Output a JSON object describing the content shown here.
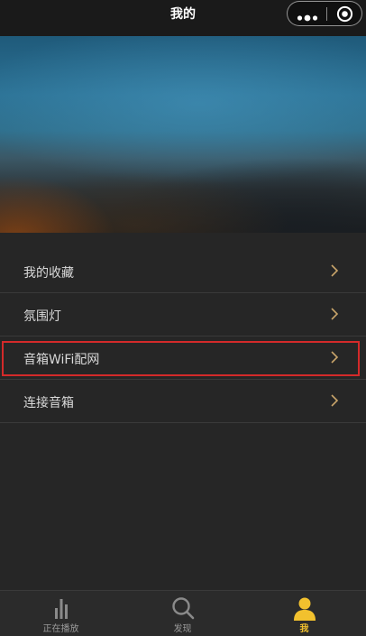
{
  "navbar": {
    "title": "我的",
    "capsule_more_icon": "more-dots-icon",
    "capsule_close_icon": "target-circle-icon"
  },
  "hero": {
    "description": ""
  },
  "menu": {
    "items": [
      {
        "label": "我的收藏",
        "icon": "chevron-right-icon"
      },
      {
        "label": "氛围灯",
        "icon": "chevron-right-icon"
      },
      {
        "label": "音箱WiFi配网",
        "icon": "chevron-right-icon",
        "highlighted": true
      },
      {
        "label": "连接音箱",
        "icon": "chevron-right-icon"
      }
    ]
  },
  "tabbar": {
    "tabs": [
      {
        "label": "正在播放",
        "icon": "equalizer-bars-icon",
        "active": false
      },
      {
        "label": "发现",
        "icon": "search-icon",
        "active": false
      },
      {
        "label": "我",
        "icon": "user-icon",
        "active": true
      }
    ]
  },
  "colors": {
    "background": "#262626",
    "navbar": "#1a1a1a",
    "chevron": "#c8a46a",
    "accent": "#f2c12e",
    "highlight_border": "#d42a2a"
  }
}
